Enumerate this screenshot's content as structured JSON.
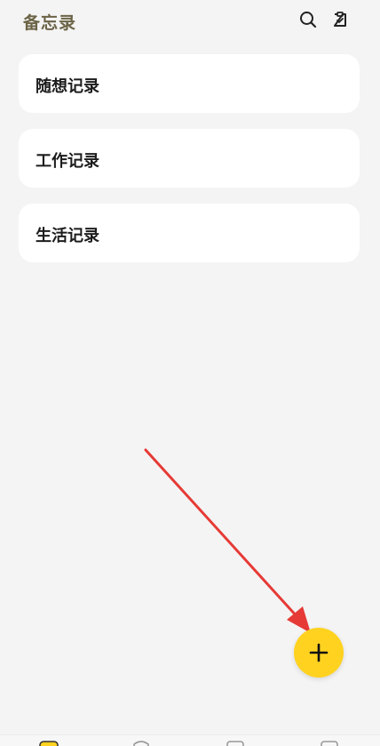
{
  "header": {
    "title": "备忘录",
    "icons": [
      "search-icon",
      "notes-icon"
    ]
  },
  "categories": [
    {
      "label": "随想记录"
    },
    {
      "label": "工作记录"
    },
    {
      "label": "生活记录"
    }
  ],
  "fab": {
    "icon": "plus-icon",
    "color": "#ffd21f"
  },
  "annotation": {
    "type": "arrow",
    "color": "#e63a36"
  },
  "bottom_nav": {
    "items": [
      {
        "icon": "memo-icon",
        "active": true
      },
      {
        "icon": "nav-icon-2",
        "active": false
      },
      {
        "icon": "nav-icon-3",
        "active": false
      },
      {
        "icon": "nav-icon-4",
        "active": false
      }
    ]
  },
  "colors": {
    "background": "#f4f4f4",
    "card": "#ffffff",
    "title": "#6b6447",
    "accent": "#ffd21f"
  }
}
